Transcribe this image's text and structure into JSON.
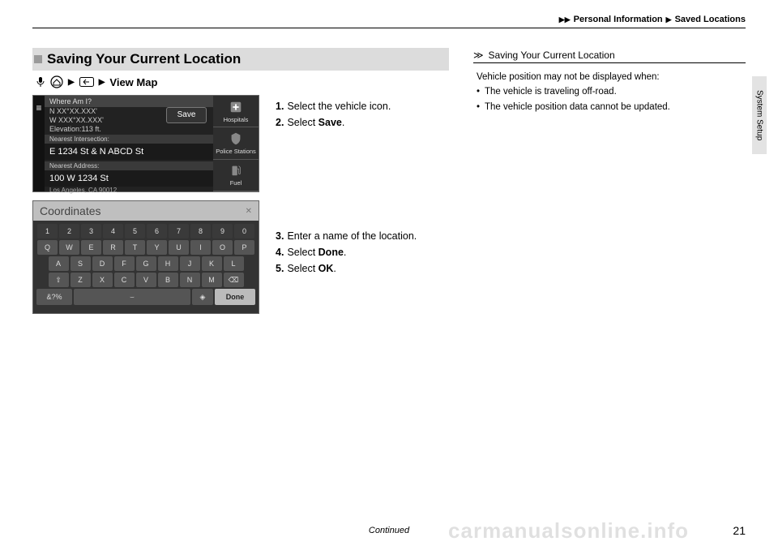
{
  "header": {
    "crumb1": "Personal Information",
    "crumb2": "Saved Locations"
  },
  "side_tab": "System Setup",
  "section_title": "Saving Your Current Location",
  "path": {
    "view_map": "View Map"
  },
  "steps_a": [
    {
      "n": "1.",
      "t": "Select the vehicle icon."
    },
    {
      "n": "2.",
      "t_pre": "Select ",
      "t_bold": "Save",
      "t_post": "."
    }
  ],
  "steps_b": [
    {
      "n": "3.",
      "t": "Enter a name of the location."
    },
    {
      "n": "4.",
      "t_pre": "Select ",
      "t_bold": "Done",
      "t_post": "."
    },
    {
      "n": "5.",
      "t_pre": "Select ",
      "t_bold": "OK",
      "t_post": "."
    }
  ],
  "shot1": {
    "title": "Where Am I?",
    "coord1": "N XX°XX.XXX'",
    "coord2": "W XXX°XX.XXX'",
    "elev": "Elevation:113 ft.",
    "save": "Save",
    "near_int_label": "Nearest Intersection:",
    "near_int": "E 1234 St & N ABCD St",
    "near_addr_label": "Nearest Address:",
    "near_addr": "100 W 1234 St",
    "city": "Los Angeles, CA 90012",
    "icons": {
      "hospitals": "Hospitals",
      "police": "Police Stations",
      "fuel": "Fuel"
    }
  },
  "shot2": {
    "title": "Coordinates",
    "rows": {
      "num": [
        "1",
        "2",
        "3",
        "4",
        "5",
        "6",
        "7",
        "8",
        "9",
        "0"
      ],
      "r1": [
        "Q",
        "W",
        "E",
        "R",
        "T",
        "Y",
        "U",
        "I",
        "O",
        "P"
      ],
      "r2": [
        "A",
        "S",
        "D",
        "F",
        "G",
        "H",
        "J",
        "K",
        "L"
      ],
      "r3": [
        "Z",
        "X",
        "C",
        "V",
        "B",
        "N",
        "M"
      ]
    },
    "shift": "⇧",
    "bksp": "⌫",
    "sym": "&?%",
    "mic": "◈",
    "done": "Done"
  },
  "info": {
    "title": "Saving Your Current Location",
    "line1": "Vehicle position may not be displayed when:",
    "b1": "The vehicle is traveling off-road.",
    "b2": "The vehicle position data cannot be updated."
  },
  "footer": {
    "continued": "Continued",
    "page": "21"
  },
  "watermark": "carmanualsonline.info"
}
